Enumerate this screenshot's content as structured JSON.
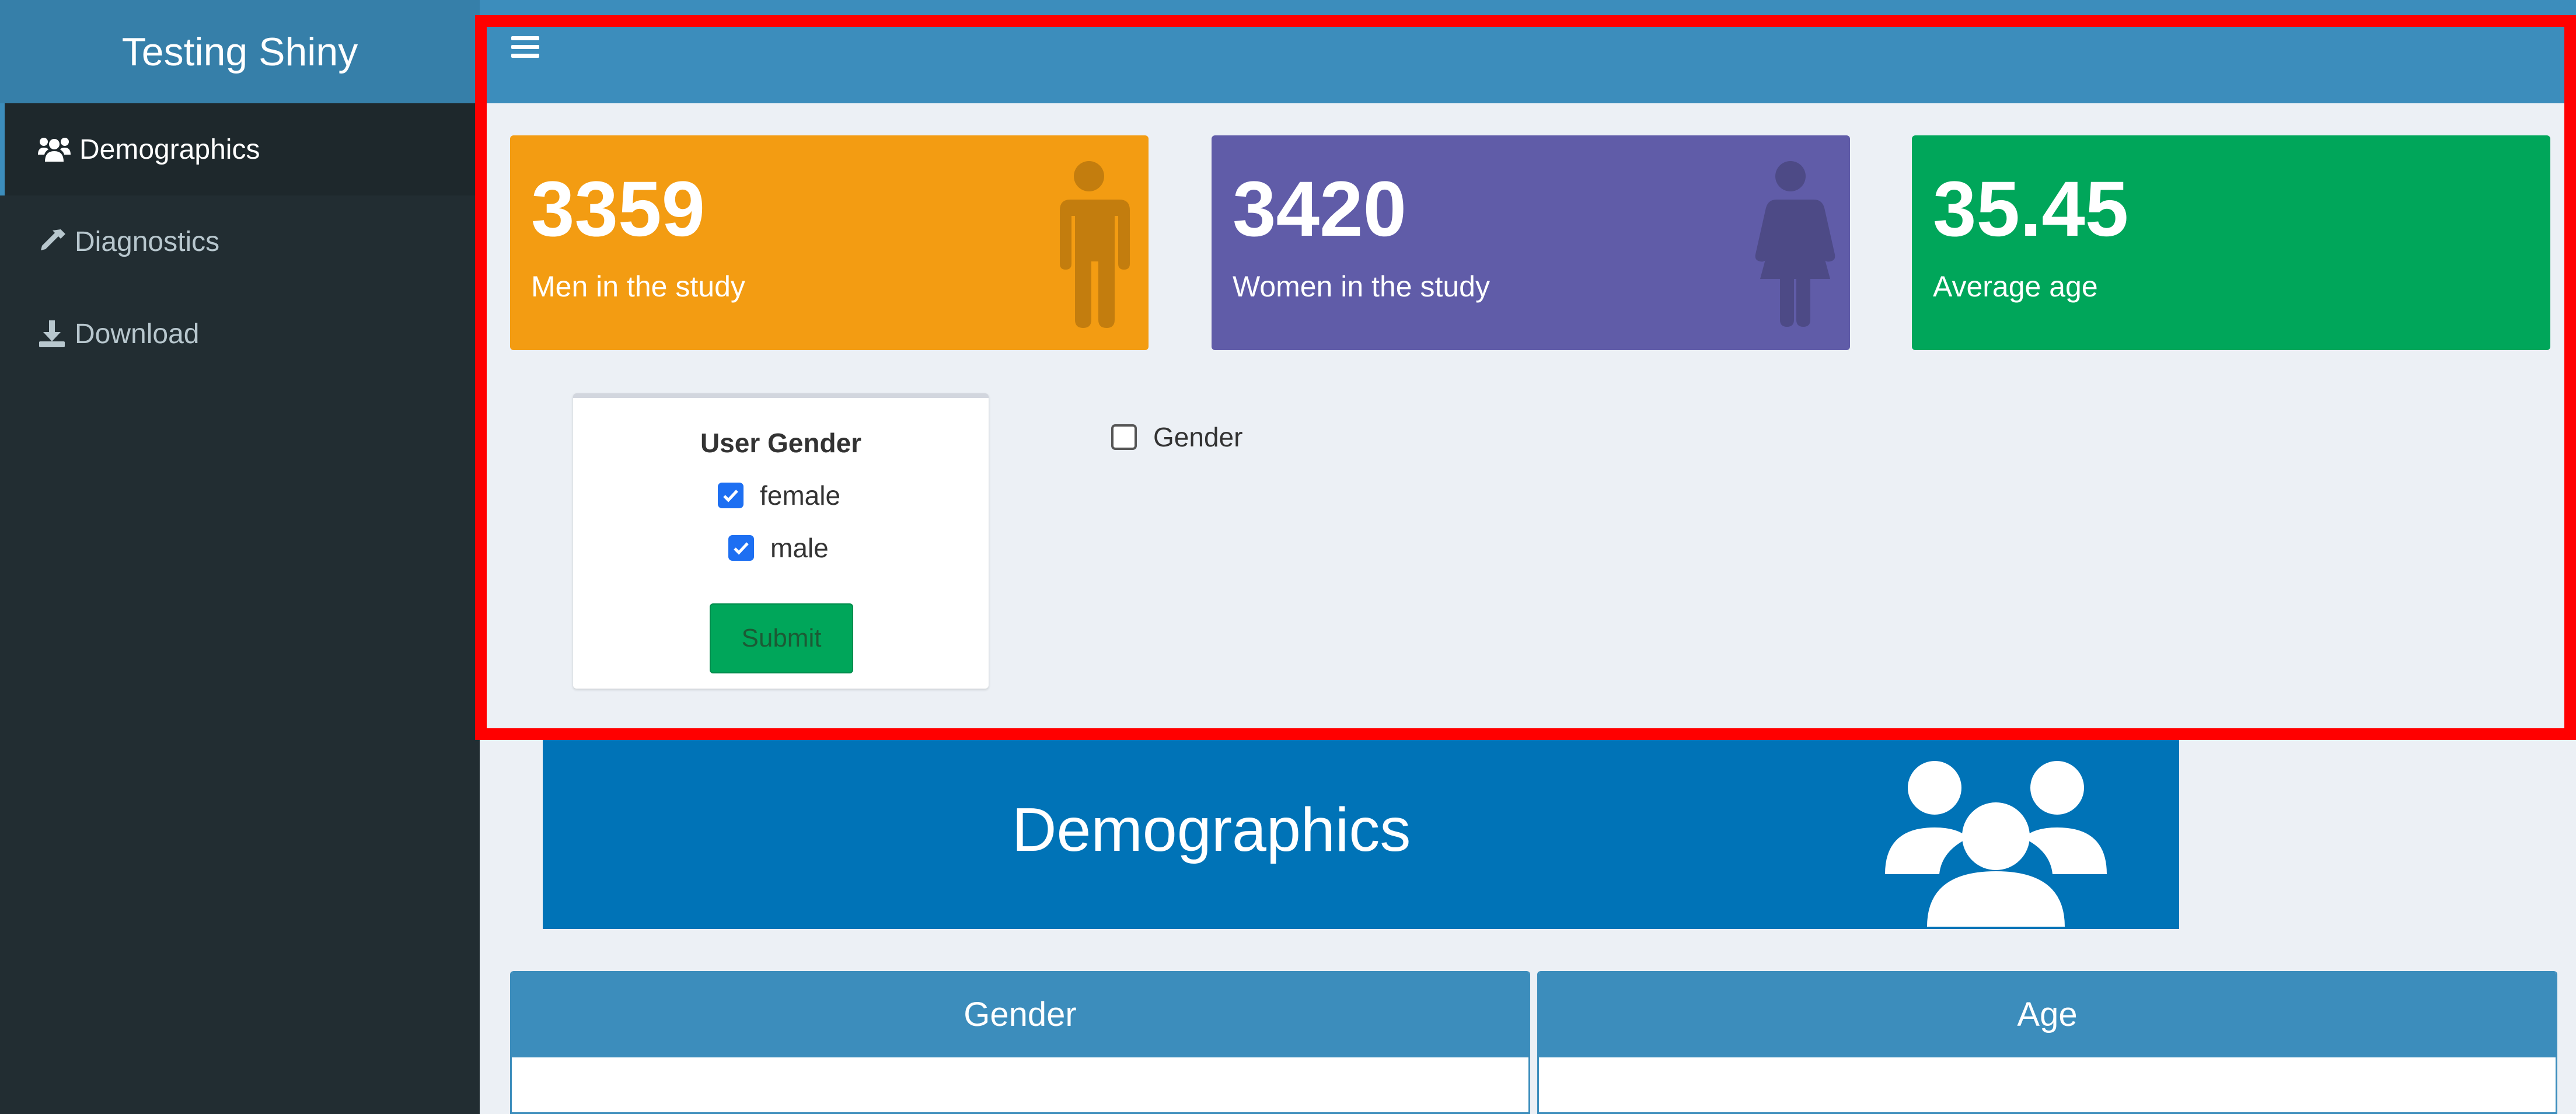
{
  "app": {
    "title": "Testing Shiny"
  },
  "sidebar": {
    "items": [
      {
        "label": "Demographics",
        "icon": "users-icon",
        "active": true
      },
      {
        "label": "Diagnostics",
        "icon": "eyedropper-icon",
        "active": false
      },
      {
        "label": "Download",
        "icon": "download-icon",
        "active": false
      }
    ]
  },
  "value_boxes": [
    {
      "value": "3359",
      "label": "Men in the study",
      "color": "#f39c12",
      "icon": "male-icon"
    },
    {
      "value": "3420",
      "label": "Women in the study",
      "color": "#605ca8",
      "icon": "female-icon"
    },
    {
      "value": "35.45",
      "label": "Average age",
      "color": "#00a65a"
    }
  ],
  "filter": {
    "title": "User Gender",
    "options": [
      {
        "label": "female",
        "checked": true
      },
      {
        "label": "male",
        "checked": true
      }
    ],
    "submit_label": "Submit"
  },
  "gender_toggle": {
    "label": "Gender",
    "checked": false
  },
  "banner": {
    "title": "Demographics",
    "color": "#0073b7"
  },
  "panels": [
    {
      "title": "Gender"
    },
    {
      "title": "Age"
    }
  ],
  "colors": {
    "header": "#3c8dbc",
    "sidebar": "#222d32",
    "highlight": "#ff0000"
  }
}
